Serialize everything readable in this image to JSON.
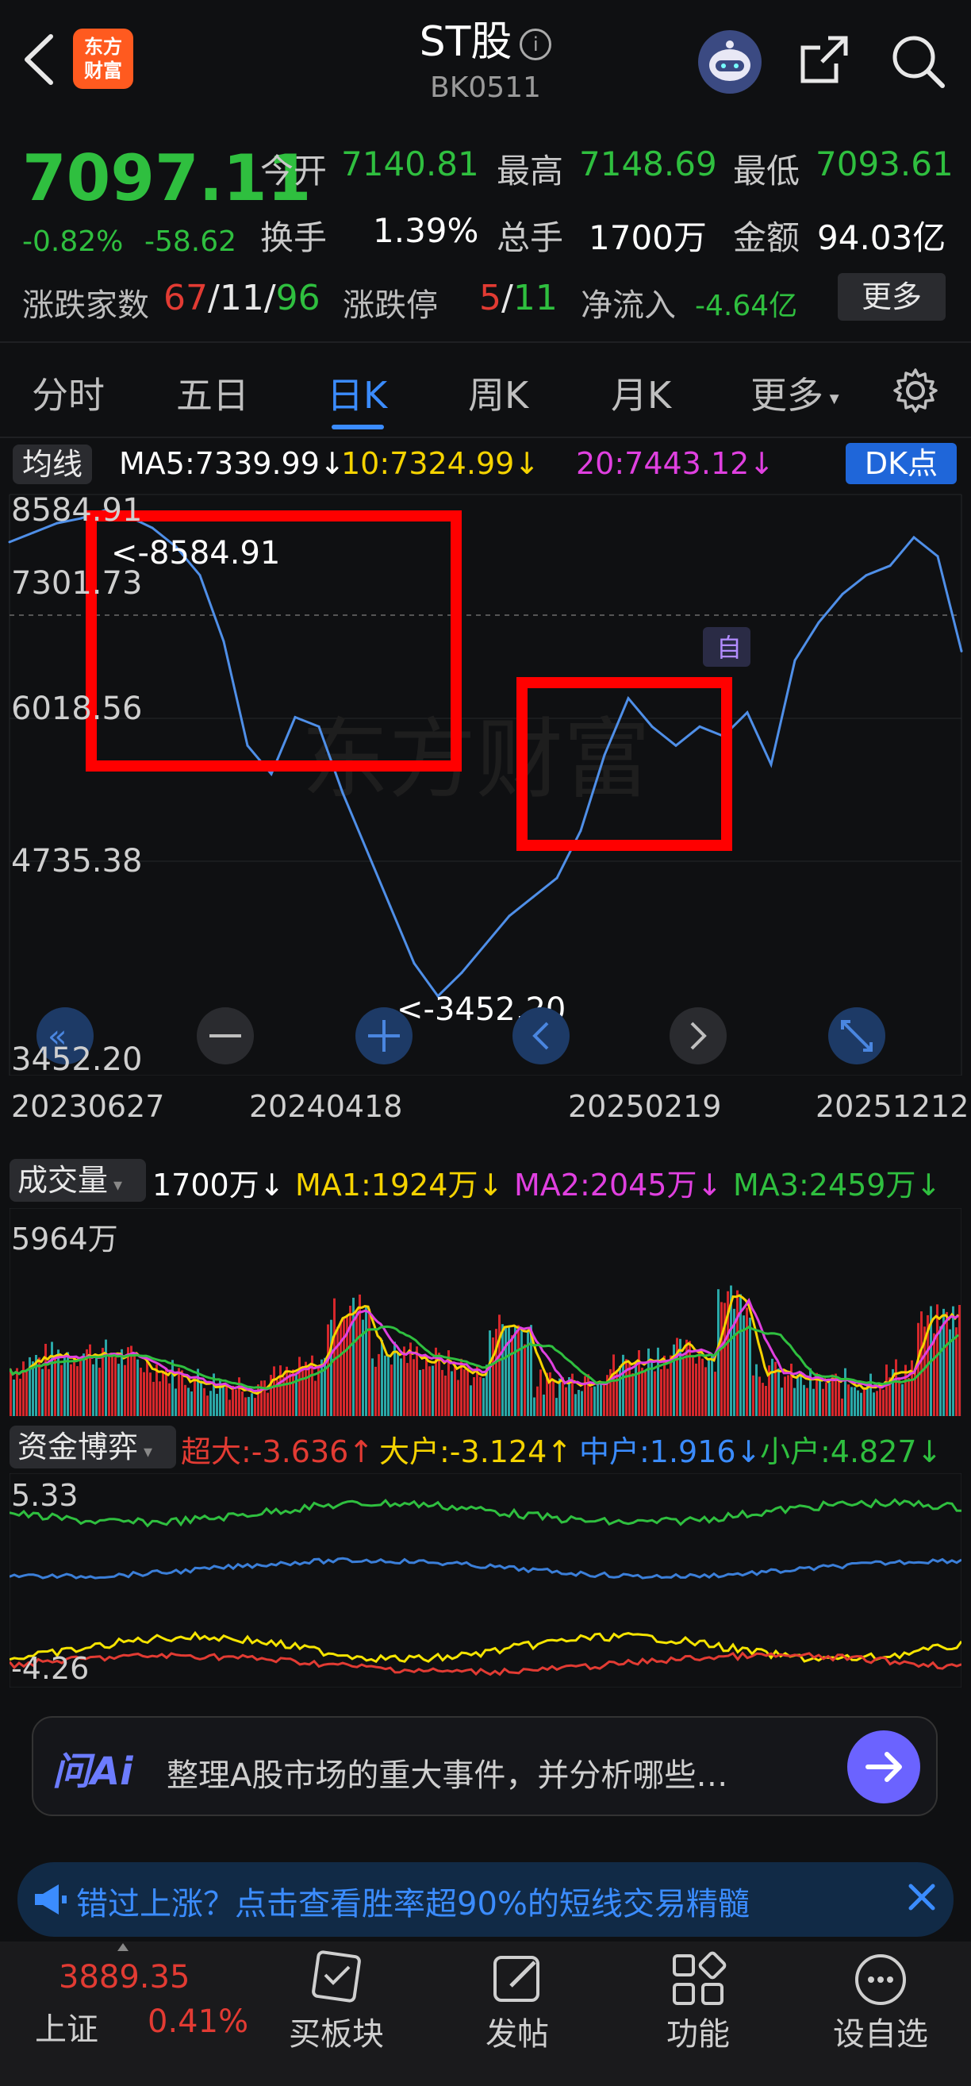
{
  "header": {
    "title": "ST股",
    "code": "BK0511",
    "logo_text": "东方\n财富"
  },
  "quote": {
    "price": "7097.11",
    "pct": "-0.82%",
    "change": "-58.62",
    "rows": [
      [
        {
          "label": "今开",
          "value": "7140.81",
          "color": "green"
        },
        {
          "label": "最高",
          "value": "7148.69",
          "color": "green"
        },
        {
          "label": "最低",
          "value": "7093.61",
          "color": "green"
        }
      ],
      [
        {
          "label": "换手",
          "value": "1.39%",
          "color": "white"
        },
        {
          "label": "总手",
          "value": "1700万",
          "color": "white"
        },
        {
          "label": "金额",
          "value": "94.03亿",
          "color": "white"
        }
      ]
    ],
    "updown_label": "涨跌家数",
    "up": "67",
    "flat": "11",
    "down": "96",
    "limit_label": "涨跌停",
    "limit_up": "5",
    "limit_down": "11",
    "inflow_label": "净流入",
    "inflow": "-4.64亿",
    "more_button": "更多"
  },
  "tabs": [
    "分时",
    "五日",
    "日K",
    "周K",
    "月K",
    "更多"
  ],
  "ma": {
    "chip": "均线",
    "ma5": "MA5:7339.99↓",
    "ma10": "10:7324.99↓",
    "ma20": "20:7443.12↓",
    "dk": "DK点"
  },
  "main_chart": {
    "y_labels": [
      "8584.91",
      "7301.73",
      "6018.56",
      "4735.38",
      "3452.20"
    ],
    "x_labels": [
      "20230627",
      "20240418",
      "20250219",
      "20251212"
    ],
    "high_annotation": "<-8584.91",
    "low_annotation": "<-3452.20",
    "marker_label": "自",
    "watermark": "东方财富"
  },
  "volume": {
    "chip": "成交量",
    "value": "1700万↓",
    "ma1": "MA1:1924万↓",
    "ma2": "MA2:2045万↓",
    "ma3": "MA3:2459万↓",
    "max_label": "5964万"
  },
  "fund": {
    "chip": "资金博弈",
    "super": "超大:-3.636↑",
    "large": "大户:-3.124↑",
    "mid": "中户:1.916↓",
    "small": "小户:4.827↓",
    "max_label": "5.33",
    "min_label": "-4.26"
  },
  "ai": {
    "logo": "问Ai",
    "text": "整理A股市场的重大事件，并分析哪些…"
  },
  "banner": {
    "text": "错过上涨？点击查看胜率超90%的短线交易精髓"
  },
  "bottom": {
    "index_value": "3889.35",
    "index_name": "上证",
    "index_pct": "0.41%",
    "items": [
      "买板块",
      "发帖",
      "功能",
      "设自选"
    ]
  },
  "chart_data": {
    "type": "line",
    "title": "",
    "xlabel": "",
    "ylabel": "",
    "x_ticks": [
      "20230627",
      "20240418",
      "20250219",
      "20251212"
    ],
    "ylim": [
      3452.2,
      8584.91
    ],
    "series": [
      {
        "values": [
          8250,
          8350,
          8450,
          8500,
          8584.91,
          8520,
          8400,
          8200,
          7900,
          7200,
          6100,
          5800,
          6400,
          6300,
          5600,
          5000,
          4400,
          3800,
          3452.2,
          3700,
          4000,
          4300,
          4500,
          4700,
          5200,
          6000,
          6600,
          6300,
          6100,
          6300,
          6200,
          6450,
          5900,
          7000,
          7400,
          7700,
          7900,
          8000,
          8300,
          8100,
          7097.11
        ]
      }
    ]
  }
}
